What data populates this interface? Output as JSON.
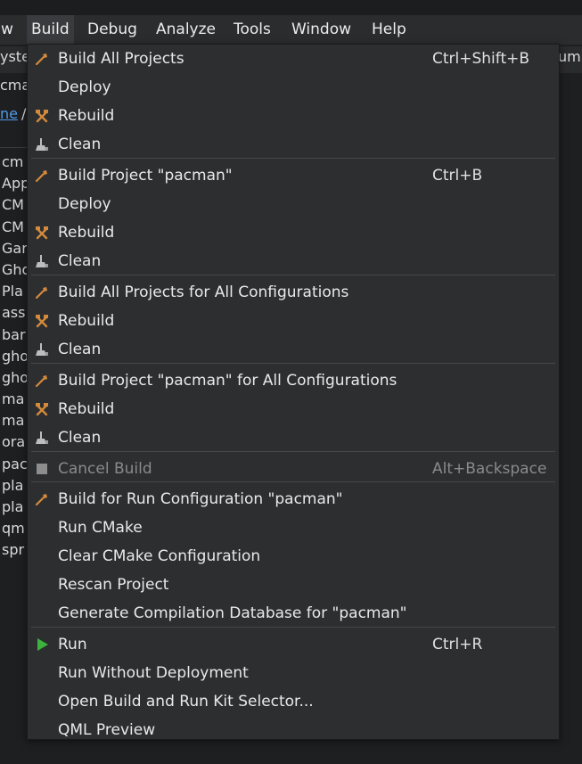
{
  "menubar": {
    "items": [
      {
        "label": "w"
      },
      {
        "label": "Build",
        "active": true
      },
      {
        "label": "Debug"
      },
      {
        "label": "Analyze"
      },
      {
        "label": "Tools"
      },
      {
        "label": "Window"
      },
      {
        "label": "Help"
      }
    ]
  },
  "background": {
    "tab_left": "yste",
    "tab_right": "um",
    "breadcrumb_row1": "cma",
    "breadcrumb_link": "ne",
    "breadcrumb_sep": "/",
    "file_list": [
      "cm",
      "App",
      "CM",
      "CM",
      "Gar",
      "Gho",
      "Pla",
      "ass",
      "bar",
      "gho",
      "gho",
      "ma",
      "ma",
      "ora",
      "pac",
      "pla",
      "pla",
      "qm",
      "spr"
    ]
  },
  "build_menu": {
    "colors": {
      "hammer": "#d38a3c",
      "run": "#3db33d",
      "cancel": "#8d8d8d"
    },
    "items": [
      {
        "label": "Build All Projects",
        "shortcut": "Ctrl+Shift+B",
        "icon": "hammer-icon"
      },
      {
        "label": "Deploy",
        "shortcut": "",
        "icon": ""
      },
      {
        "label": "Rebuild",
        "shortcut": "",
        "icon": "rebuild-icon"
      },
      {
        "label": "Clean",
        "shortcut": "",
        "icon": "clean-icon"
      },
      {
        "label": "Build Project \"pacman\"",
        "shortcut": "Ctrl+B",
        "icon": "hammer-icon"
      },
      {
        "label": "Deploy",
        "shortcut": "",
        "icon": ""
      },
      {
        "label": "Rebuild",
        "shortcut": "",
        "icon": "rebuild-icon"
      },
      {
        "label": "Clean",
        "shortcut": "",
        "icon": "clean-icon"
      },
      {
        "label": "Build All Projects for All Configurations",
        "shortcut": "",
        "icon": "hammer-icon"
      },
      {
        "label": "Rebuild",
        "shortcut": "",
        "icon": "rebuild-icon"
      },
      {
        "label": "Clean",
        "shortcut": "",
        "icon": "clean-icon"
      },
      {
        "label": "Build Project \"pacman\" for All Configurations",
        "shortcut": "",
        "icon": "hammer-icon"
      },
      {
        "label": "Rebuild",
        "shortcut": "",
        "icon": "rebuild-icon"
      },
      {
        "label": "Clean",
        "shortcut": "",
        "icon": "clean-icon"
      },
      {
        "label": "Cancel Build",
        "shortcut": "Alt+Backspace",
        "icon": "stop-icon",
        "disabled": true
      },
      {
        "label": "Build for Run Configuration \"pacman\"",
        "shortcut": "",
        "icon": "hammer-icon"
      },
      {
        "label": "Run CMake",
        "shortcut": "",
        "icon": ""
      },
      {
        "label": "Clear CMake Configuration",
        "shortcut": "",
        "icon": ""
      },
      {
        "label": "Rescan Project",
        "shortcut": "",
        "icon": ""
      },
      {
        "label": "Generate Compilation Database for \"pacman\"",
        "shortcut": "",
        "icon": ""
      },
      {
        "label": "Run",
        "shortcut": "Ctrl+R",
        "icon": "run-icon"
      },
      {
        "label": "Run Without Deployment",
        "shortcut": "",
        "icon": ""
      },
      {
        "label": "Open Build and Run Kit Selector...",
        "shortcut": "",
        "icon": ""
      },
      {
        "label": "QML Preview",
        "shortcut": "",
        "icon": ""
      }
    ]
  }
}
